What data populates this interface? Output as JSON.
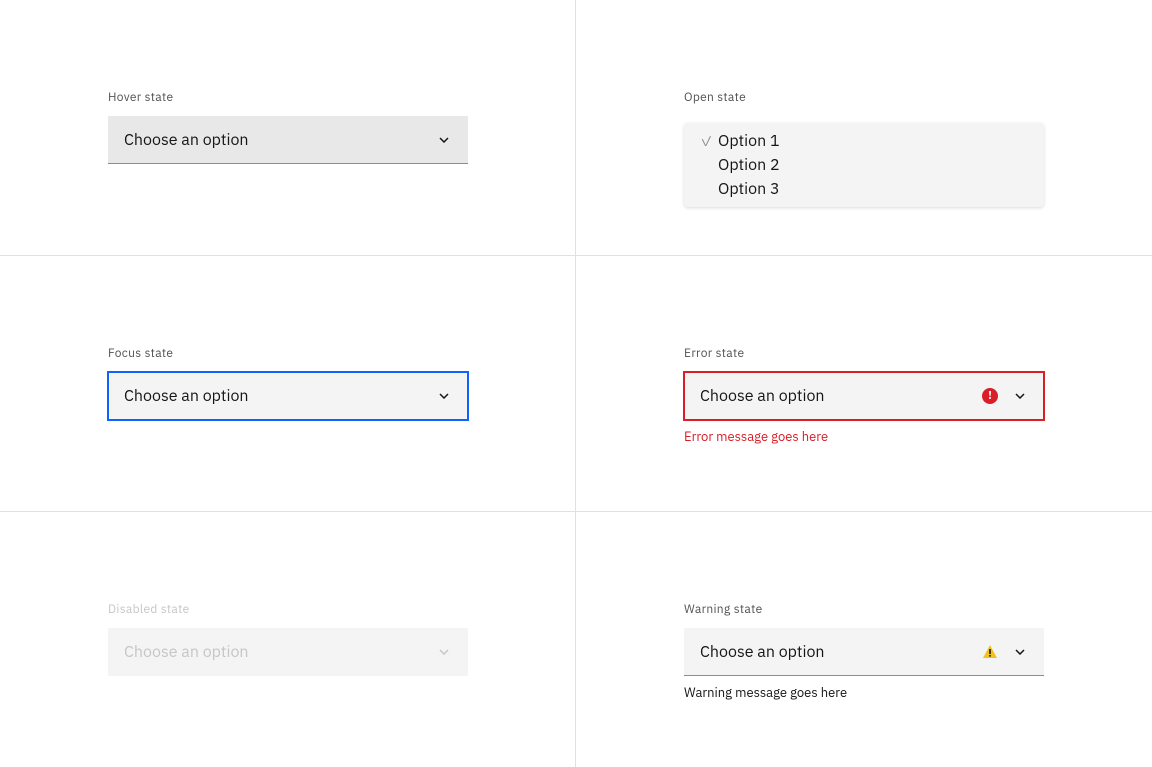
{
  "states": {
    "hover": {
      "label": "Hover state",
      "placeholder": "Choose an option"
    },
    "open": {
      "label": "Open state",
      "options": [
        "Option 1",
        "Option 2",
        "Option 3"
      ]
    },
    "focus": {
      "label": "Focus state",
      "placeholder": "Choose an option"
    },
    "error": {
      "label": "Error state",
      "placeholder": "Choose an option",
      "message": "Error message goes here"
    },
    "disabled": {
      "label": "Disabled state",
      "placeholder": "Choose an option"
    },
    "warning": {
      "label": "Warning state",
      "placeholder": "Choose an option",
      "message": "Warning message goes here"
    }
  },
  "colors": {
    "focus": "#0f62fe",
    "error": "#da1e28",
    "warning": "#f1c21b",
    "text": "#161616",
    "secondary": "#525252",
    "disabled": "#c6c6c6",
    "field": "#f4f4f4",
    "hover": "#e8e8e8"
  }
}
